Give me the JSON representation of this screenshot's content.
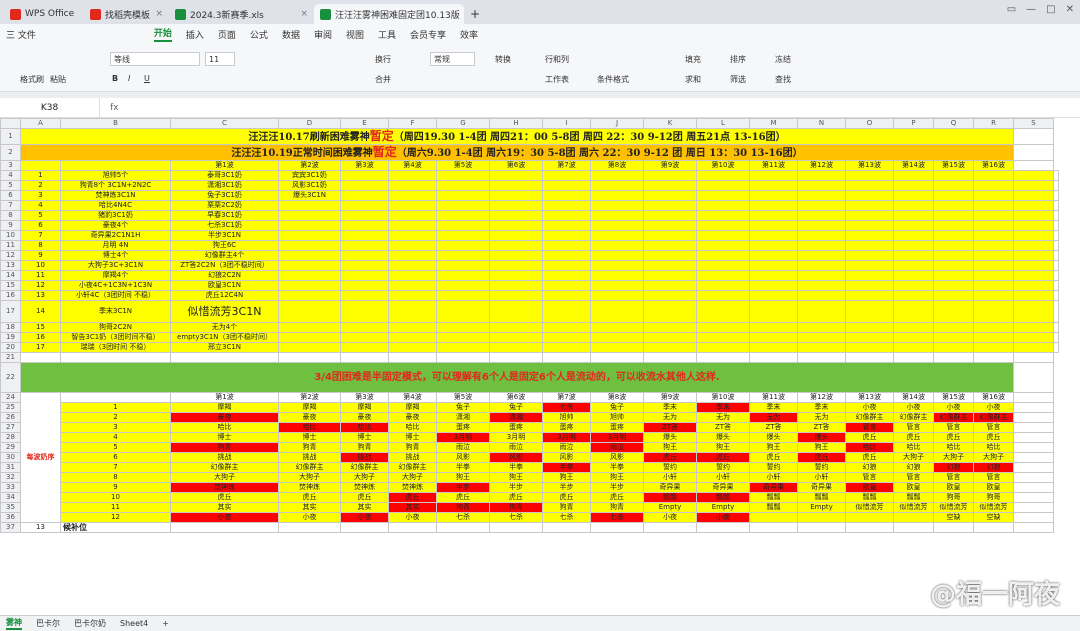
{
  "tabs": [
    {
      "label": "WPS Office",
      "color": "#e0291c"
    },
    {
      "label": "找稻壳模板",
      "color": "#e0291c"
    },
    {
      "label": "2024.3新赛季.xls",
      "color": "#1a8f3d"
    },
    {
      "label": "汪汪汪雾神困难固定团10.13版",
      "color": "#1a8f3d"
    }
  ],
  "menu": {
    "file": "三 文件",
    "items": [
      "开始",
      "插入",
      "页面",
      "公式",
      "数据",
      "审阅",
      "视图",
      "工具",
      "会员专享",
      "效率"
    ]
  },
  "ribbon": {
    "painter": "格式刷",
    "paste": "粘贴",
    "font": "等线",
    "size": "11",
    "wrap": "换行",
    "numfmt": "常规",
    "convert": "转换",
    "rowcol": "行和列",
    "sheet": "工作表",
    "cond": "条件格式",
    "fill": "填充",
    "sort": "排序",
    "freeze": "冻结",
    "sum": "求和",
    "filter": "筛选",
    "find": "查找",
    "merge": "合并"
  },
  "formula": {
    "cell": "K38",
    "fx": "fx"
  },
  "columns": [
    "A",
    "B",
    "C",
    "D",
    "E",
    "F",
    "G",
    "H",
    "I",
    "J",
    "K",
    "L",
    "M",
    "N",
    "O",
    "P",
    "Q",
    "R",
    "S"
  ],
  "banner1": {
    "pre": "汪汪汪10.17刷新困难雾神",
    "hl": "暂定",
    "post": "（周四19.30 1-4团 周四21：00 5-8团 周四 22：30 9-12团 周五21点 13-16团）"
  },
  "banner2": {
    "pre": "汪汪汪10.19正常时间困难雾神",
    "hl": "暂定",
    "post": "（周六9.30 1-4团 周六19：30 5-8团 周六 22：30 9-12 团 周日 13：30 13-16团）"
  },
  "waves": [
    "第1波",
    "第2波",
    "第3波",
    "第4波",
    "第5波",
    "第6波",
    "第7波",
    "第8波",
    "第9波",
    "第10波",
    "第11波",
    "第12波",
    "第13波",
    "第14波",
    "第15波",
    "第16波"
  ],
  "list": [
    {
      "row": "4",
      "n": "1",
      "b": "旭帅5个",
      "c": "泰哥3C1奶",
      "d": "宾宾3C1奶"
    },
    {
      "row": "5",
      "n": "2",
      "b": "狗青8个 3C1N+2N2C",
      "c": "潇湘3C1奶",
      "d": "风影3C1奶"
    },
    {
      "row": "6",
      "n": "3",
      "b": "焚神炼3C1N",
      "c": "兔子3C1奶",
      "d": "爆头3C1N"
    },
    {
      "row": "7",
      "n": "4",
      "b": "哈比4N4C",
      "c": "栗栗2C2奶",
      "d": ""
    },
    {
      "row": "8",
      "n": "5",
      "b": "猪豹3C1奶",
      "c": "早春3C1奶",
      "d": ""
    },
    {
      "row": "9",
      "n": "6",
      "b": "豪夜4个",
      "c": "七杀3C1奶",
      "d": ""
    },
    {
      "row": "10",
      "n": "7",
      "b": "奇异果2C1N1H",
      "c": "半步3C1N",
      "d": ""
    },
    {
      "row": "11",
      "n": "8",
      "b": "月明 4N",
      "c": "狗王6C",
      "d": ""
    },
    {
      "row": "12",
      "n": "9",
      "b": "博士4个",
      "c": "幻像群主4个",
      "d": ""
    },
    {
      "row": "13",
      "n": "10",
      "b": "大狗子3C+3C1N",
      "c": "ZT答2C2N（3团不稳时间）",
      "d": ""
    },
    {
      "row": "14",
      "n": "11",
      "b": "摩羯4个",
      "c": "幻狼2C2N",
      "d": ""
    },
    {
      "row": "15",
      "n": "12",
      "b": "小夜4C+1C3N+1C3N",
      "c": "欧皇3C1N",
      "d": ""
    },
    {
      "row": "16",
      "n": "13",
      "b": "小轩4C（3团时间 不稳）",
      "c": "虎丘12C4N",
      "d": ""
    },
    {
      "row": "17",
      "n": "14",
      "b": "季末3C1N",
      "c": "似惜流芳3C1N",
      "d": ""
    },
    {
      "row": "18",
      "n": "15",
      "b": "狗哥2C2N",
      "c": "无为4个",
      "d": ""
    },
    {
      "row": "19",
      "n": "16",
      "b": "智告3C1奶（3团时间不稳）",
      "c": "empty3C1N（3团不稳时间）",
      "d": ""
    },
    {
      "row": "20",
      "n": "17",
      "b": "瑞瑞（3团时间 不稳）",
      "c": "邢立3C1N",
      "d": ""
    }
  ],
  "notice": "3/4团困难是半固定模式，可以理解有6个人是固定6个人是流动的，可以收流水其他人这样.",
  "side_label": "每波奶序",
  "bottom_label": "候补位",
  "schedule": [
    {
      "n": "1",
      "cells": [
        "摩羯",
        "摩羯",
        "摩羯",
        "摩羯",
        "兔子",
        "兔子",
        "七杀",
        "兔子",
        "季末",
        "季末",
        "季末",
        "季末",
        "小夜",
        "小夜",
        "小夜",
        "小夜"
      ],
      "red": [
        6,
        9
      ]
    },
    {
      "n": "2",
      "cells": [
        "豪夜",
        "豪夜",
        "豪夜",
        "豪夜",
        "潇湘",
        "潇湘",
        "旭帅",
        "旭帅",
        "无为",
        "无为",
        "无为",
        "无为",
        "幻像群主",
        "幻像群主",
        "幻像群主",
        "幻像群主"
      ],
      "red": [
        0,
        5,
        10,
        14,
        15
      ]
    },
    {
      "n": "3",
      "cells": [
        "哈比",
        "哈比",
        "哈比",
        "哈比",
        "蛋疼",
        "蛋疼",
        "蛋疼",
        "蛋疼",
        "ZT答",
        "ZT答",
        "ZT答",
        "ZT答",
        "管言",
        "管言",
        "管言",
        "管言"
      ],
      "red": [
        1,
        2,
        8,
        12
      ]
    },
    {
      "n": "4",
      "cells": [
        "博士",
        "博士",
        "博士",
        "博士",
        "3月明",
        "3月明",
        "3月明",
        "3月明",
        "爆头",
        "爆头",
        "爆头",
        "爆头",
        "虎丘",
        "虎丘",
        "虎丘",
        "虎丘"
      ],
      "red": [
        4,
        6,
        7,
        11
      ]
    },
    {
      "n": "5",
      "cells": [
        "狗青",
        "狗青",
        "狗青",
        "狗青",
        "雨泣",
        "雨泣",
        "雨泣",
        "雨泣",
        "狗王",
        "狗王",
        "狗王",
        "狗王",
        "哈比",
        "哈比",
        "哈比",
        "哈比"
      ],
      "red": [
        0,
        7,
        12
      ]
    },
    {
      "n": "6",
      "cells": [
        "挑战",
        "挑战",
        "挑战",
        "挑战",
        "风影",
        "风影",
        "风影",
        "风影",
        "虎丘",
        "虎丘",
        "虎丘",
        "虎丘",
        "虎丘",
        "大狗子",
        "大狗子",
        "大狗子"
      ],
      "red": [
        2,
        5,
        8,
        9,
        11
      ]
    },
    {
      "n": "7",
      "cells": [
        "幻像群主",
        "幻像群主",
        "幻像群主",
        "幻像群主",
        "半拳",
        "半拳",
        "半拳",
        "半拳",
        "誓约",
        "誓约",
        "誓约",
        "誓约",
        "幻狼",
        "幻狼",
        "幻狼",
        "幻狼"
      ],
      "red": [
        6,
        14,
        15
      ]
    },
    {
      "n": "8",
      "cells": [
        "大狗子",
        "大狗子",
        "大狗子",
        "大狗子",
        "狗王",
        "狗王",
        "狗王",
        "狗王",
        "小轩",
        "小轩",
        "小轩",
        "小轩",
        "管言",
        "管言",
        "管言",
        "管言"
      ],
      "red": []
    },
    {
      "n": "9",
      "cells": [
        "焚神炼",
        "焚神炼",
        "焚神炼",
        "焚神炼",
        "半步",
        "半步",
        "半步",
        "半步",
        "奇异果",
        "奇异果",
        "奇异果",
        "奇异果",
        "欧皇",
        "欧皇",
        "欧皇",
        "欧皇"
      ],
      "red": [
        0,
        4,
        10,
        12
      ]
    },
    {
      "n": "10",
      "cells": [
        "虎丘",
        "虎丘",
        "虎丘",
        "虎丘",
        "虎丘",
        "虎丘",
        "虎丘",
        "虎丘",
        "瓢瓢",
        "瓢瓢",
        "瓢瓢",
        "瓢瓢",
        "瓢瓢",
        "瓢瓢",
        "狗哥",
        "狗哥"
      ],
      "red": [
        3,
        8,
        9
      ]
    },
    {
      "n": "11",
      "cells": [
        "其实",
        "其实",
        "其实",
        "其实",
        "狗青",
        "狗青",
        "狗青",
        "狗青",
        "Empty",
        "Empty",
        "瓢瓢",
        "Empty",
        "似惜流芳",
        "似惜流芳",
        "似惜流芳",
        "似惜流芳"
      ],
      "red": [
        3,
        4,
        5
      ]
    },
    {
      "n": "12",
      "cells": [
        "小夜",
        "小夜",
        "小夜",
        "小夜",
        "七杀",
        "七杀",
        "七杀",
        "七杀",
        "小夜",
        "小夜",
        "",
        "",
        "",
        "",
        "空缺",
        "空缺"
      ],
      "red": [
        0,
        2,
        7,
        9
      ]
    }
  ],
  "sheets": [
    "雾神",
    "巴卡尔",
    "巴卡尔奶",
    "Sheet4"
  ],
  "watermark": "@福一阿夜"
}
